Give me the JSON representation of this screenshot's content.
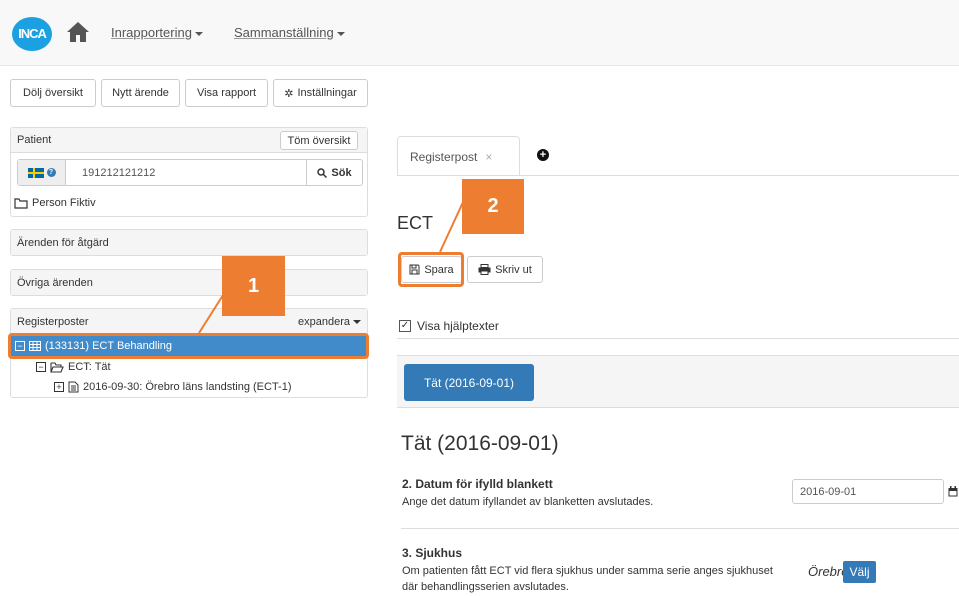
{
  "navbar": {
    "logo": "INCA",
    "menu": [
      {
        "label": "Inrapportering"
      },
      {
        "label": "Sammanställning"
      }
    ]
  },
  "toolbar": {
    "hide_overview": "Dölj översikt",
    "new_case": "Nytt ärende",
    "show_report": "Visa rapport",
    "settings": "Inställningar"
  },
  "patient_panel": {
    "title": "Patient",
    "clear_button": "Töm översikt",
    "search_value": "191212121212",
    "search_button": "Sök",
    "patient_name": "Person Fiktiv"
  },
  "panels": {
    "action_cases": "Ärenden för åtgärd",
    "other_cases": "Övriga ärenden",
    "register_posts": "Registerposter",
    "expand": "expandera"
  },
  "tree": {
    "root": "(133131) ECT Behandling",
    "child": "ECT: Tät",
    "grandchild": "2016-09-30: Örebro läns landsting (ECT-1)"
  },
  "badges": {
    "one": "1",
    "two": "2"
  },
  "form": {
    "tab_label": "Registerpost",
    "heading": "ECT",
    "save": "Spara",
    "print": "Skriv ut",
    "show_help": "Visa hjälptexter",
    "section_pill": "Tät (2016-09-01)",
    "section_heading": "Tät (2016-09-01)",
    "q2_title": "2. Datum för ifylld blankett",
    "q2_help": "Ange det datum ifyllandet av blanketten avslutades.",
    "q2_value": "2016-09-01",
    "q3_title": "3. Sjukhus",
    "q3_help_1": "Om patienten fått ECT vid flera sjukhus under samma serie anges sjukhuset",
    "q3_help_2": "där behandlingsserien avslutades.",
    "q3_value": "Örebro",
    "q3_choose": "Välj"
  },
  "colors": {
    "accent": "#337ab7",
    "highlight": "#ed7d31",
    "selected_row": "#428bca"
  }
}
